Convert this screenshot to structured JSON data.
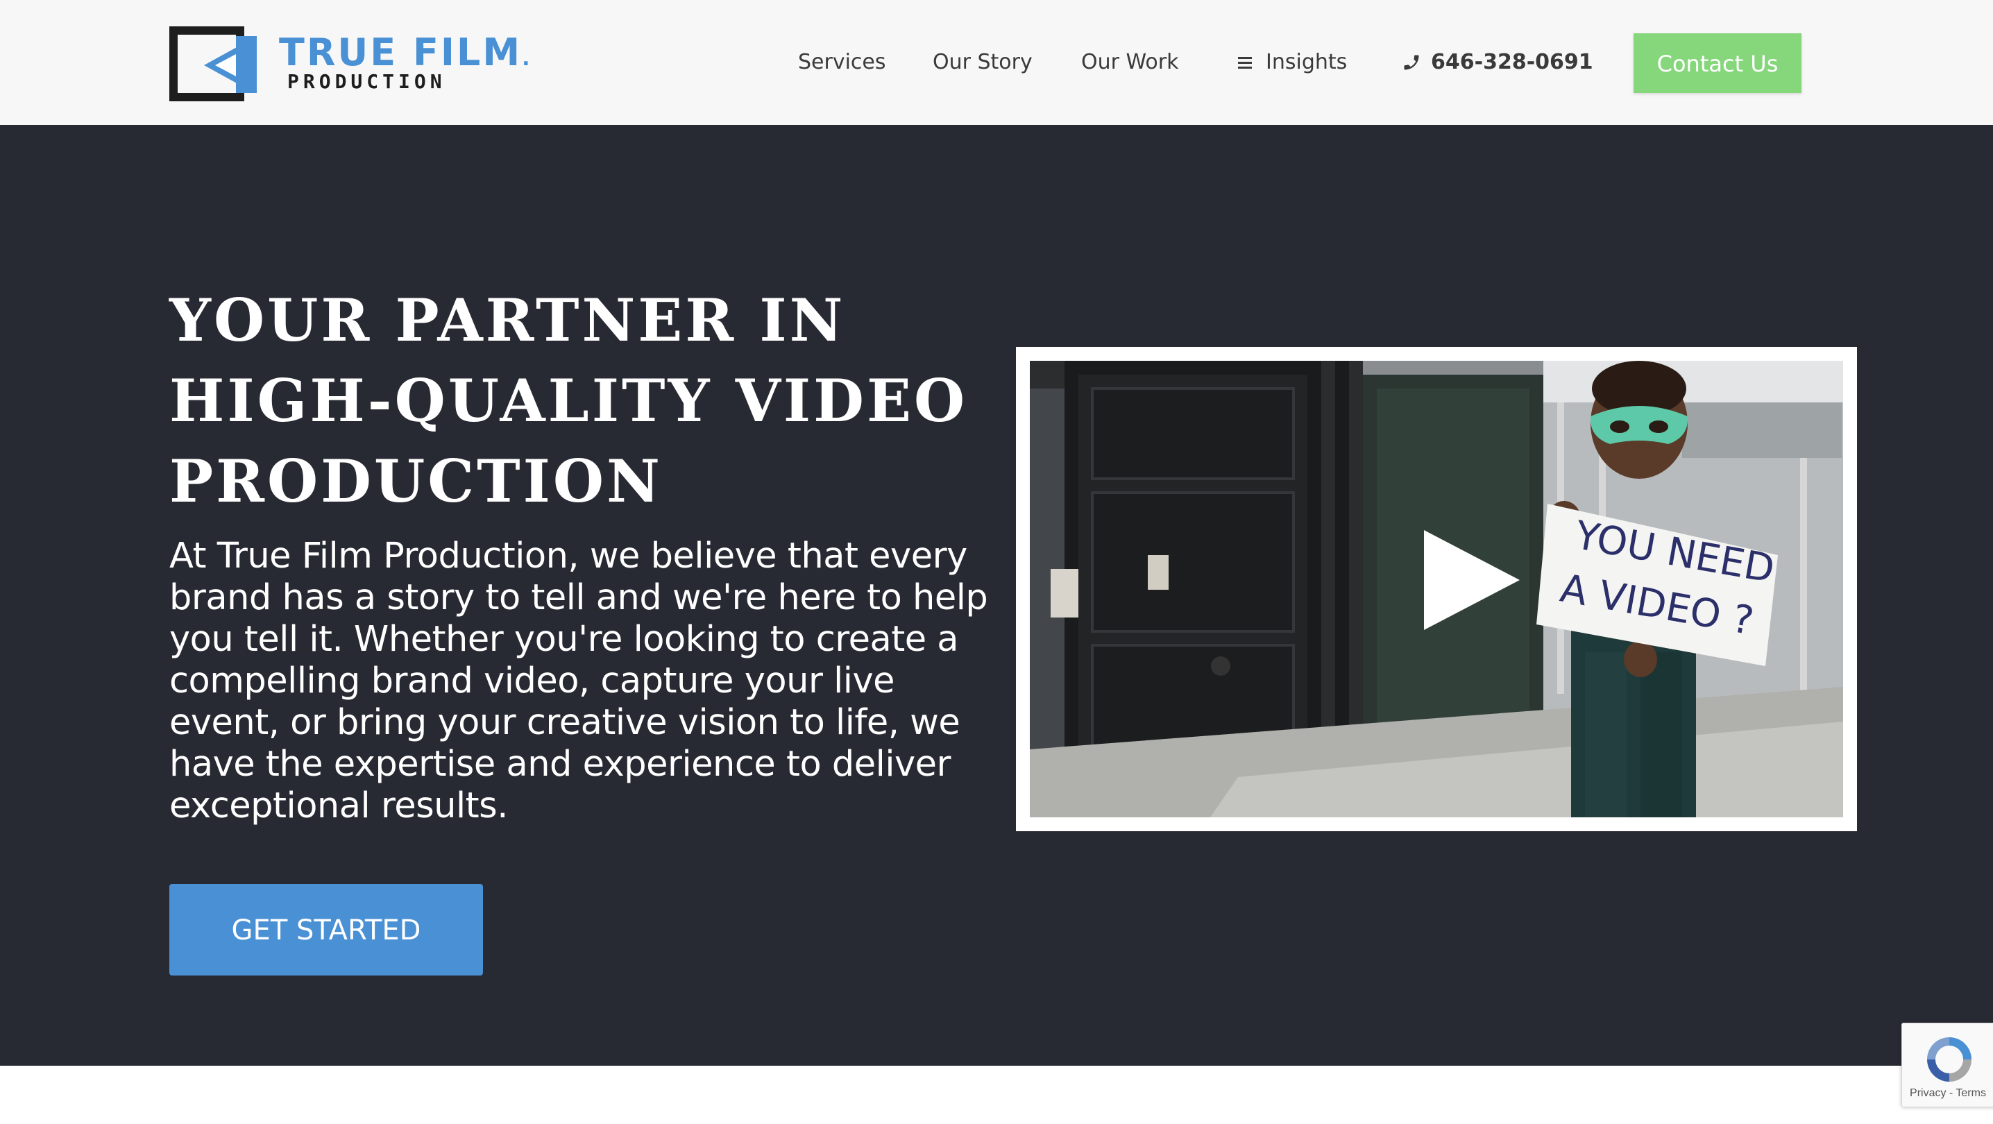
{
  "brand": {
    "name_line1": "TRUE FILM",
    "name_dot": ".",
    "name_line2": "PRODUCTION",
    "accent_color": "#4a90d4",
    "dark_color": "#1e1e1e"
  },
  "nav": {
    "items": [
      {
        "label": "Services",
        "icon": ""
      },
      {
        "label": "Our Story",
        "icon": ""
      },
      {
        "label": "Our Work",
        "icon": ""
      },
      {
        "label": "Insights",
        "icon": "menu-lines-icon"
      }
    ],
    "phone": {
      "label": "646-328-0691",
      "icon": "phone-icon"
    },
    "contact_button": "Contact Us",
    "contact_color": "#86d77c"
  },
  "hero": {
    "title_line1": "YOUR PARTNER IN",
    "title_line2": "HIGH-QUALITY VIDEO",
    "title_line3": "PRODUCTION",
    "description": "At True Film Production, we believe that every brand has a story to tell and we're here to help you tell it. Whether you're looking to create a compelling brand video, capture your live event, or bring your creative vision to life, we have the expertise and experience to deliver exceptional results.",
    "cta_button": "GET STARTED",
    "background_color": "#282a33"
  },
  "video": {
    "sign_line1": "YOU NEED",
    "sign_line2": "A VIDEO ?",
    "play_icon": "play-icon"
  },
  "recaptcha": {
    "privacy": "Privacy",
    "separator": " - ",
    "terms": "Terms"
  }
}
